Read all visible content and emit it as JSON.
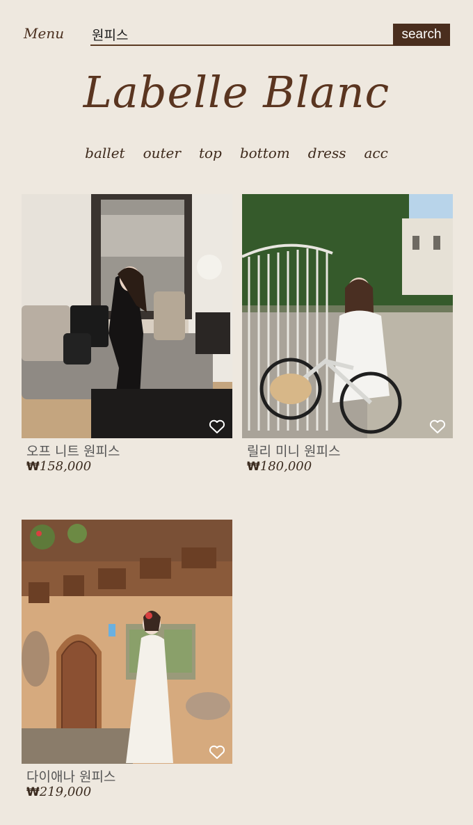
{
  "header": {
    "menu_label": "Menu",
    "search_value": "원피스",
    "search_button": "search"
  },
  "brand": {
    "logo_text": "Labelle Blanc"
  },
  "categories": [
    "ballet",
    "outer",
    "top",
    "bottom",
    "dress",
    "acc"
  ],
  "products": [
    {
      "name": "오프 니트 원피스",
      "currency": "₩",
      "price": "158,000",
      "image": "woman-in-black-dress-on-sofa"
    },
    {
      "name": "릴리 미니 원피스",
      "currency": "₩",
      "price": "180,000",
      "image": "woman-in-white-dress-with-bicycle"
    },
    {
      "name": "다이애나 원피스",
      "currency": "₩",
      "price": "219,000",
      "image": "woman-in-white-dress-by-wooden-door"
    }
  ],
  "icons": {
    "wishlist": "heart-outline-icon"
  },
  "colors": {
    "background": "#eee8df",
    "brand": "#4a2e1e",
    "text": "#555555"
  }
}
